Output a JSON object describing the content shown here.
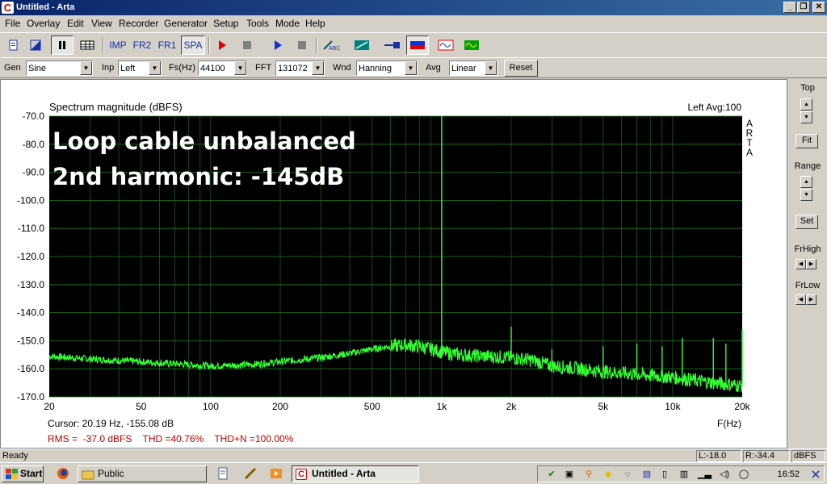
{
  "window": {
    "title": "Untitled - Arta",
    "app_icon_glyph": "C",
    "min_glyph": "_",
    "max_glyph": "❐",
    "close_glyph": "✕"
  },
  "menu": [
    "File",
    "Overlay",
    "Edit",
    "View",
    "Recorder",
    "Generator",
    "Setup",
    "Tools",
    "Mode",
    "Help"
  ],
  "toolbar": {
    "modes": [
      "IMP",
      "FR2",
      "FR1",
      "SPA"
    ],
    "active_mode": "SPA",
    "icons": [
      "new-document-icon",
      "open-icon",
      "pause-icon",
      "table-icon",
      "record-red-icon",
      "stop-icon",
      "play-blue-icon",
      "stop-icon",
      "abc-icon",
      "generator-icon",
      "probe-icon",
      "signal-icon",
      "overlay-red-icon",
      "overlay-green-icon"
    ]
  },
  "params": {
    "gen_label": "Gen",
    "gen_value": "Sine",
    "inp_label": "Inp",
    "inp_value": "Left",
    "fs_label": "Fs(Hz)",
    "fs_value": "44100",
    "fft_label": "FFT",
    "fft_value": "131072",
    "wnd_label": "Wnd",
    "wnd_value": "Hanning",
    "avg_label": "Avg",
    "avg_value": "Linear",
    "reset_label": "Reset"
  },
  "right_panel": {
    "top_label": "Top",
    "fit_label": "Fit",
    "range_label": "Range",
    "set_label": "Set",
    "frhigh_label": "FrHigh",
    "frlow_label": "FrLow"
  },
  "chart_data": {
    "type": "line",
    "title": "Spectrum magnitude (dBFS)",
    "channel_info": "Left  Avg:100",
    "annotation_line1": "Loop cable unbalanced",
    "annotation_line2": "2nd harmonic: -145dB",
    "brand_letters": [
      "A",
      "R",
      "T",
      "A"
    ],
    "xlabel": "F(Hz)",
    "xscale": "log",
    "xlim": [
      20,
      20000
    ],
    "ylim": [
      -170,
      -70
    ],
    "xticks": [
      20,
      50,
      100,
      200,
      500,
      1000,
      2000,
      5000,
      10000,
      20000
    ],
    "xtick_labels": [
      "20",
      "50",
      "100",
      "200",
      "500",
      "1k",
      "2k",
      "5k",
      "10k",
      "20k"
    ],
    "yticks": [
      -70,
      -80,
      -90,
      -100,
      -110,
      -120,
      -130,
      -140,
      -150,
      -160,
      -170
    ],
    "ytick_labels": [
      "-70.0",
      "-80.0",
      "-90.0",
      "-100.0",
      "-110.0",
      "-120.0",
      "-130.0",
      "-140.0",
      "-150.0",
      "-160.0",
      "-170.0"
    ],
    "grid": true,
    "background": "#000000",
    "grid_color": "#1e7a1e",
    "line_color": "#33ff33",
    "noise_floor": {
      "x": [
        20,
        30,
        50,
        80,
        100,
        150,
        200,
        300,
        400,
        500,
        600,
        700,
        800,
        900,
        1000,
        1200,
        1500,
        2000,
        2500,
        3000,
        4000,
        5000,
        7000,
        10000,
        15000,
        20000
      ],
      "y": [
        -155.5,
        -156.5,
        -157.5,
        -158.5,
        -159,
        -158.5,
        -157.5,
        -156,
        -154.5,
        -153,
        -152,
        -151.5,
        -152,
        -153,
        -154,
        -155,
        -155.5,
        -156,
        -157,
        -159,
        -160,
        -161,
        -162,
        -163,
        -165,
        -166
      ]
    },
    "peaks": {
      "x": [
        1000,
        2000,
        3000,
        5000,
        7000,
        9000,
        11000,
        15000,
        17000,
        20000
      ],
      "y": [
        -70,
        -145,
        -153,
        -152,
        -151,
        -152,
        -149,
        -149,
        -151,
        -146
      ]
    },
    "cursor": "Cursor: 20.19 Hz, -155.08 dB",
    "rms_text": "RMS =  -37.0 dBFS    THD =40.76%    THD+N =100.00%"
  },
  "status": {
    "ready": "Ready",
    "left_level": "L:-18.0",
    "right_level": "R:-34.4",
    "unit": "dBFS"
  },
  "taskbar": {
    "start_label": "Start",
    "tasks": [
      "Public",
      "Untitled - Arta"
    ],
    "clock": "16:52"
  }
}
